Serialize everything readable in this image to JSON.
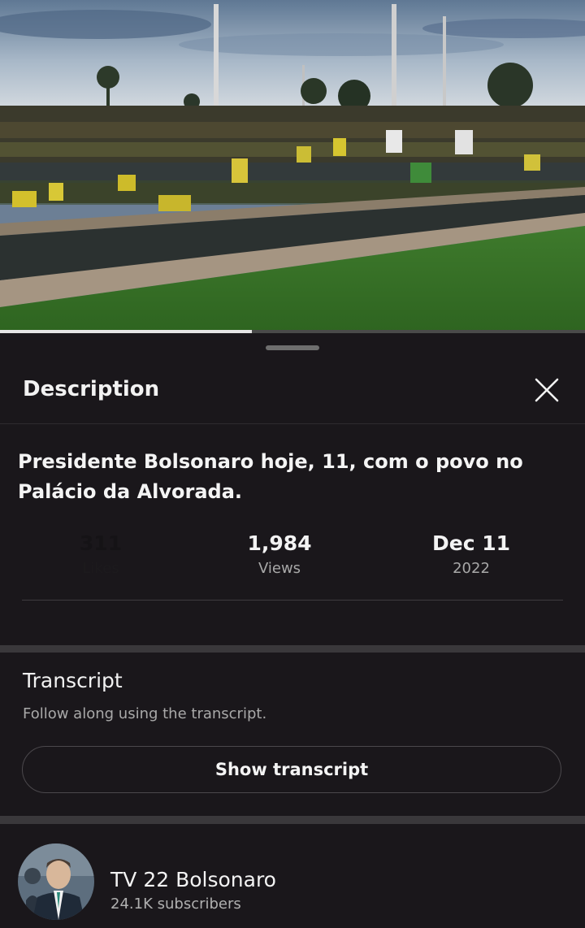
{
  "video": {
    "progress_fraction": 0.43
  },
  "description_panel": {
    "header_title": "Description",
    "close_icon": "close-icon",
    "video_title": "Presidente Bolsonaro hoje, 11, com o povo no Palácio da Alvorada.",
    "stats": {
      "likes_value": "311",
      "likes_label": "Likes",
      "views_value": "1,984",
      "views_label": "Views",
      "date_value": "Dec 11",
      "date_year": "2022"
    }
  },
  "transcript": {
    "title": "Transcript",
    "subtitle": "Follow along using the transcript.",
    "button_label": "Show transcript"
  },
  "channel": {
    "name": "TV 22 Bolsonaro",
    "subscribers": "24.1K subscribers",
    "avatar_icon": "avatar"
  },
  "colors": {
    "background": "#1a171b",
    "divider_band": "#3a383b",
    "text_primary": "#f1f1f1",
    "text_secondary": "#a8a8a8"
  }
}
